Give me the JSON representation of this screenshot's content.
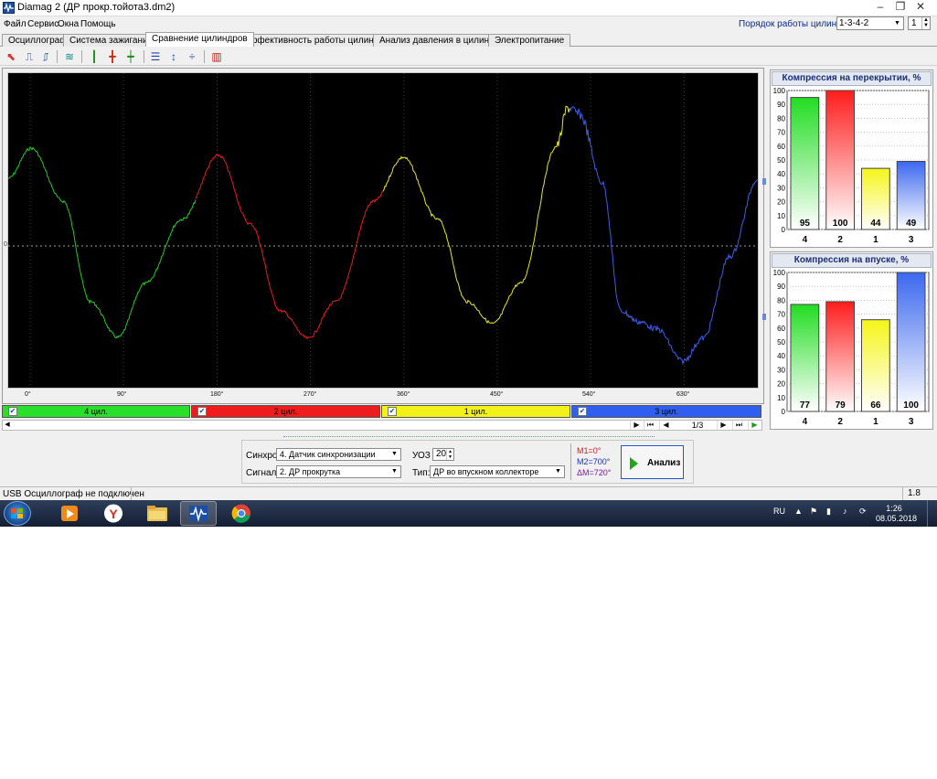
{
  "window": {
    "title": "Diamag 2 (ДР прокр.тойота3.dm2)",
    "controls": {
      "minimize": "–",
      "restore": "❐",
      "close": "✕"
    }
  },
  "menu": [
    "Файл",
    "Сервис",
    "Окна",
    "Помощь"
  ],
  "firing_order": {
    "label": "Порядок работы цилиндров",
    "value": "1-3-4-2",
    "spin": "1"
  },
  "tabs": [
    "Осциллограф",
    "Система зажигания",
    "Сравнение цилиндров",
    "Эффективность работы цилиндров",
    "Анализ давления в цилиндре",
    "Электропитание"
  ],
  "active_tab": "Сравнение цилиндров",
  "toolbar_icons": [
    "cursor-icon",
    "rise-edge-icon",
    "fall-edge-icon",
    "waves-icon",
    "marker-a-icon",
    "marker-b-icon",
    "marker-c-icon",
    "lines-icon",
    "scale-icon",
    "split-icon",
    "bar-chart-icon"
  ],
  "scope": {
    "zero_label": "0",
    "x_labels": [
      "0°",
      "90°",
      "180°",
      "270°",
      "360°",
      "450°",
      "540°",
      "630°"
    ],
    "colors": {
      "background": "#000000",
      "c1": "#22cc22",
      "c2": "#e81c1c",
      "c3": "#e6e61a",
      "c4": "#3a5ee8",
      "grid": "#3a3a3a",
      "zero": "#9a9a9a"
    }
  },
  "cylinders": [
    {
      "label": "4 цил.",
      "color": "#2adf2a",
      "checked": "✔"
    },
    {
      "label": "2 цил.",
      "color": "#ee1c1c",
      "checked": "✔"
    },
    {
      "label": "1 цил.",
      "color": "#f2f21a",
      "checked": "✔"
    },
    {
      "label": "3 цил.",
      "color": "#2f5ff0",
      "checked": "✔"
    }
  ],
  "nav": {
    "page": "1/3",
    "buttons": [
      "▶",
      "⏮",
      "◀",
      "▶",
      "⏭",
      "▶"
    ]
  },
  "controls": {
    "sync_label": "Синхро:",
    "sync_value": "4. Датчик синхронизации",
    "uoz_label": "УОЗ",
    "uoz_value": "20",
    "signal_label": "Сигнал:",
    "signal_value": "2. ДР прокрутка",
    "type_label": "Тип:",
    "type_value": "ДР во впускном коллекторе",
    "m1": "M1=0°",
    "m2": "M2=700°",
    "dm": "ΔM=720°",
    "analyze": "Анализ"
  },
  "chart_data": [
    {
      "type": "bar",
      "title": "Компрессия на перекрытии, %",
      "categories": [
        "4",
        "2",
        "1",
        "3"
      ],
      "values": [
        95,
        100,
        44,
        49
      ],
      "colors": [
        "#22dd22",
        "#ff1c1c",
        "#f5f51a",
        "#3b68ee"
      ],
      "ylim": [
        0,
        100
      ],
      "yticks": [
        0,
        10,
        20,
        30,
        40,
        50,
        60,
        70,
        80,
        90,
        100
      ],
      "grid": true
    },
    {
      "type": "bar",
      "title": "Компрессия на впуске, %",
      "categories": [
        "4",
        "2",
        "1",
        "3"
      ],
      "values": [
        77,
        79,
        66,
        100
      ],
      "colors": [
        "#22dd22",
        "#ff1c1c",
        "#f5f51a",
        "#3b68ee"
      ],
      "ylim": [
        0,
        100
      ],
      "yticks": [
        0,
        10,
        20,
        30,
        40,
        50,
        60,
        70,
        80,
        90,
        100
      ],
      "grid": true
    }
  ],
  "status": {
    "text": "USB Осциллограф не подключен",
    "version": "1.8"
  },
  "taskbar": {
    "apps": [
      "media-player-icon",
      "yandex-browser-icon",
      "explorer-folder-icon",
      "diamag-icon",
      "chrome-icon"
    ],
    "lang": "RU",
    "time": "1:26",
    "date": "08.05.2018"
  }
}
